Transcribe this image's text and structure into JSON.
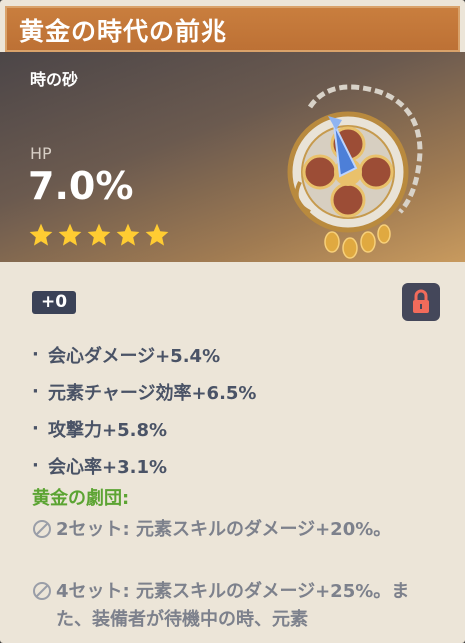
{
  "artifact": {
    "name": "黄金の時代の前兆",
    "type": "時の砂",
    "main_stat": {
      "label": "HP",
      "value": "7.0%"
    },
    "rarity": 5,
    "level": "+0",
    "locked": true
  },
  "substats": [
    {
      "text": "会心ダメージ+5.4%"
    },
    {
      "text": "元素チャージ効率+6.5%"
    },
    {
      "text": "攻撃力+5.8%"
    },
    {
      "text": "会心率+3.1%"
    }
  ],
  "set": {
    "name": "黄金の劇団:",
    "effects": [
      {
        "text": "2セット: 元素スキルのダメージ+20%。"
      },
      {
        "text": "4セット: 元素スキルのダメージ+25%。また、装備者が待機中の時、元素"
      }
    ]
  },
  "colors": {
    "title_bar": "#c97e3e",
    "set_name": "#5ca433",
    "star": "#ffcc32"
  }
}
